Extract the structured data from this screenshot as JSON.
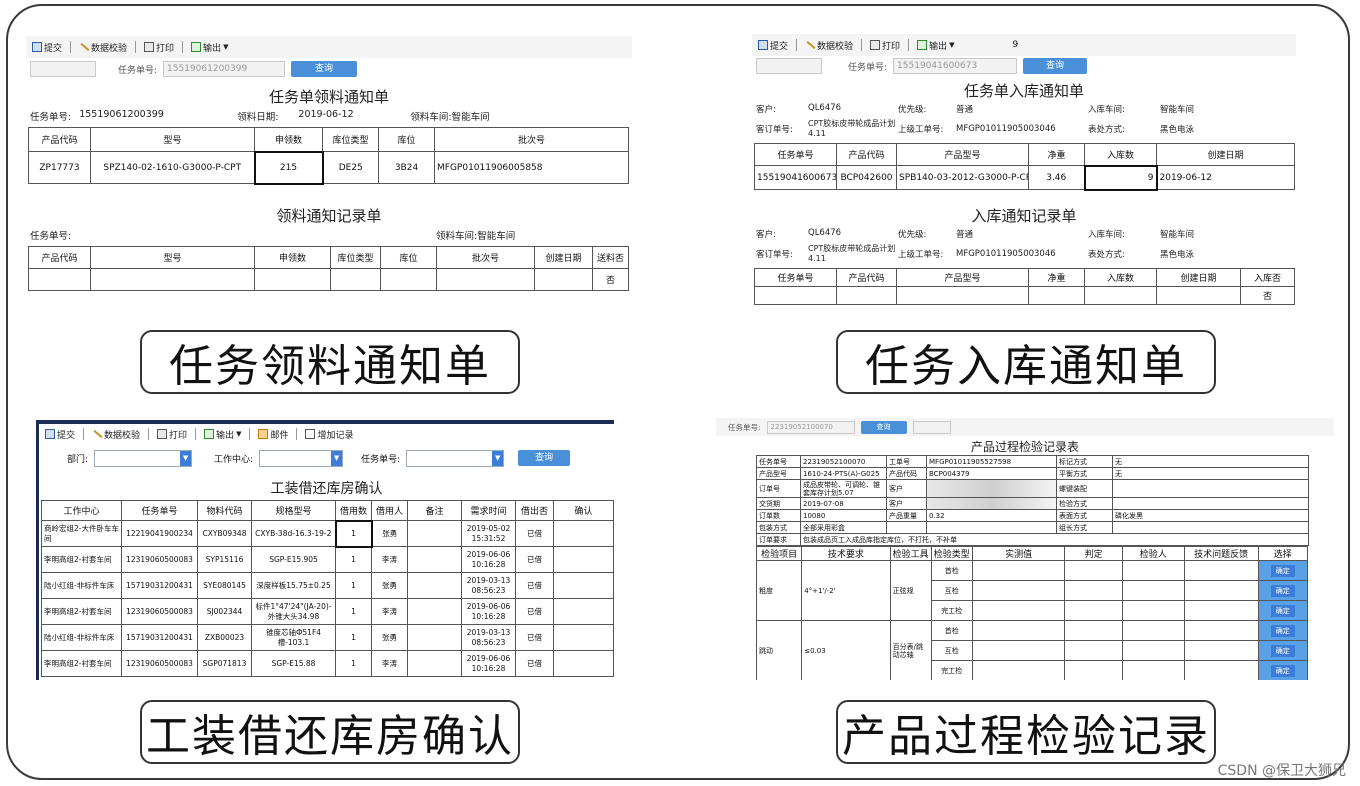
{
  "toolbar": {
    "submit": "提交",
    "validate": "数据校验",
    "print": "打印",
    "export": "输出",
    "mail": "邮件",
    "add_record": "增加记录"
  },
  "search": {
    "task_no_label": "任务单号:",
    "query": "查询",
    "dept_label": "部门:",
    "center_label": "工作中心:",
    "task_label": "任务单号:"
  },
  "p1": {
    "search_value": "15519061200399",
    "title": "任务单领料通知单",
    "task_no_label": "任务单号:",
    "task_no": "15519061200399",
    "date_label": "领料日期:",
    "date": "2019-06-12",
    "workshop_label": "领料车间:",
    "workshop": "智能车间",
    "headers": [
      "产品代码",
      "型号",
      "申领数",
      "库位类型",
      "库位",
      "批次号"
    ],
    "row": [
      "ZP17773",
      "SPZ140-02-1610-G3000-P-CPT",
      "215",
      "DE25",
      "3B24",
      "MFGP01011906005858"
    ],
    "title2": "领料通知记录单",
    "task_no_label2": "任务单号:",
    "workshop_label2": "领料车间:",
    "workshop2": "智能车间",
    "headers2": [
      "产品代码",
      "型号",
      "申领数",
      "库位类型",
      "库位",
      "批次号",
      "创建日期",
      "送料否"
    ],
    "row2_last": "否"
  },
  "p2": {
    "search_value": "15519041600673",
    "top_num": "9",
    "title": "任务单入库通知单",
    "customer_label": "客户:",
    "customer": "QL6476",
    "priority_label": "优先级:",
    "priority": "普通",
    "workshop_label": "入库车间:",
    "workshop": "智能车间",
    "order_label": "客订单号:",
    "order": "CPT胶标皮带轮成品计划4.11",
    "parent_label": "上级工单号:",
    "parent": "MFGP01011905003046",
    "surface_label": "表处方式:",
    "surface": "黑色电泳",
    "headers": [
      "任务单号",
      "产品代码",
      "产品型号",
      "净重",
      "入库数",
      "创建日期"
    ],
    "row": [
      "15519041600673",
      "BCP042600",
      "SPB140-03-2012-G3000-P-CPT",
      "3.46",
      "9",
      "2019-06-12"
    ],
    "title2": "入库通知记录单",
    "headers2": [
      "任务单号",
      "产品代码",
      "产品型号",
      "净重",
      "入库数",
      "创建日期",
      "入库否"
    ],
    "row2_last": "否"
  },
  "p3": {
    "title": "工装借还库房确认",
    "headers": [
      "工作中心",
      "任务单号",
      "物料代码",
      "规格型号",
      "借用数",
      "借用人",
      "备注",
      "需求时间",
      "借出否",
      "确认"
    ],
    "rows": [
      [
        "商岭宏组2-大件卧车车间",
        "12219041900234",
        "CXYB09348",
        "CXYB-38d-16.3-19-2",
        "1",
        "张勇",
        "",
        "2019-05-02 15:31:52",
        "已借",
        ""
      ],
      [
        "李明高组2-衬套车间",
        "12319060500083",
        "SYP15116",
        "SGP-Е15.905",
        "1",
        "李涛",
        "",
        "2019-06-06 10:16:28",
        "已借",
        ""
      ],
      [
        "陆小红组-非标件车床",
        "15719031200431",
        "SYE080145",
        "深度样板15.75±0.25",
        "1",
        "张勇",
        "",
        "2019-03-13 08:56:23",
        "已借",
        ""
      ],
      [
        "李明高组2-衬套车间",
        "12319060500083",
        "SJ002344",
        "标件1°47'24\"(JA-20)-外锥大头34.98",
        "1",
        "李涛",
        "",
        "2019-06-06 10:16:28",
        "已借",
        ""
      ],
      [
        "陆小红组-非标件车床",
        "15719031200431",
        "ZXB00023",
        "锥度芯轴Ф51F4槽-103.1",
        "1",
        "张勇",
        "",
        "2019-03-13 08:56:23",
        "已借",
        ""
      ],
      [
        "李明高组2-衬套车间",
        "12319060500083",
        "SGP071813",
        "SGP-Е15.88",
        "1",
        "李涛",
        "",
        "2019-06-06 10:16:28",
        "已借",
        ""
      ]
    ]
  },
  "p4": {
    "search_value": "22319052100070",
    "title": "产品过程检验记录表",
    "info": [
      [
        "任务单号",
        "22319052100070",
        "工单号",
        "MFGP01011905527598",
        "标记方式",
        "无"
      ],
      [
        "产品型号",
        "1610-24-PTS(A)-G025",
        "产品代码",
        "BCP004379",
        "平衡方式",
        "无"
      ],
      [
        "订单号",
        "成品皮带轮、可调轮、锥套库存计划5.07",
        "客户",
        "",
        "螺键装配",
        ""
      ],
      [
        "交货期",
        "2019-07-08",
        "客户",
        "",
        "检验方式",
        ""
      ],
      [
        "订单数",
        "10080",
        "产品重量",
        "0.32",
        "表面方式",
        "磷化发黑"
      ],
      [
        "包装方式",
        "全部采用彩盒",
        "",
        "",
        "组长方式",
        ""
      ]
    ],
    "req_label": "订单要求",
    "req": "包装成品页工入成品库指定库位，不打托，不补单",
    "headers": [
      "检验项目",
      "技术要求",
      "检验工具",
      "检验类型",
      "实测值",
      "判定",
      "检验人",
      "技术问题反馈",
      "选择"
    ],
    "items": [
      {
        "item": "粗度",
        "spec": "4°+1'/-2'",
        "tool": "正弦规",
        "types": [
          "首检",
          "互检",
          "完工检"
        ]
      },
      {
        "item": "跳动",
        "spec": "≤0.03",
        "tool": "百分表/跳动芯轴",
        "types": [
          "首检",
          "互检",
          "完工检"
        ]
      }
    ],
    "confirm": "确定"
  },
  "captions": {
    "c1": "任务领料通知单",
    "c2": "任务入库通知单",
    "c3": "工装借还库房确认",
    "c4": "产品过程检验记录"
  },
  "watermark": "CSDN @保卫大狮兄"
}
